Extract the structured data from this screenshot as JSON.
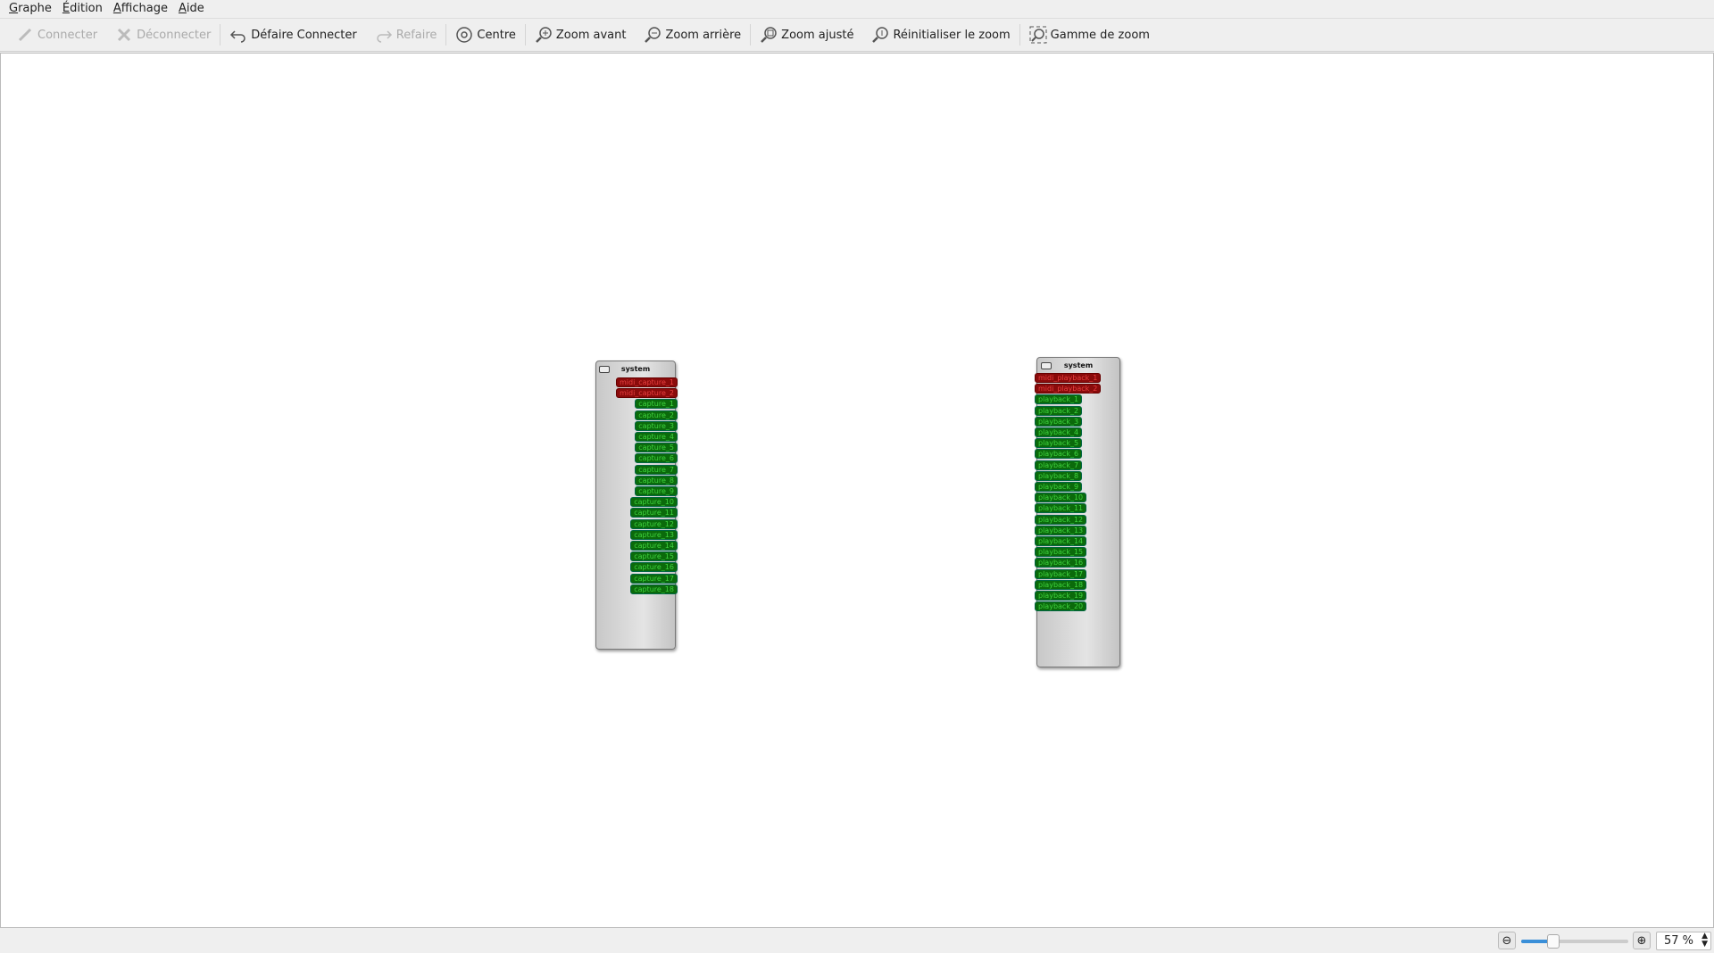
{
  "menu": [
    "Graphe",
    "Édition",
    "Affichage",
    "Aide"
  ],
  "toolbar": {
    "connect": "Connecter",
    "disconnect": "Déconnecter",
    "undo": "Défaire Connecter",
    "redo": "Refaire",
    "center": "Centre",
    "zoom_in": "Zoom avant",
    "zoom_out": "Zoom arrière",
    "zoom_fit": "Zoom ajusté",
    "zoom_reset": "Réinitialiser le zoom",
    "zoom_range": "Gamme de zoom"
  },
  "capture_client": {
    "title": "system",
    "midi_ports": [
      "midi_capture_1",
      "midi_capture_2"
    ],
    "audio_ports": [
      "capture_1",
      "capture_2",
      "capture_3",
      "capture_4",
      "capture_5",
      "capture_6",
      "capture_7",
      "capture_8",
      "capture_9",
      "capture_10",
      "capture_11",
      "capture_12",
      "capture_13",
      "capture_14",
      "capture_15",
      "capture_16",
      "capture_17",
      "capture_18"
    ]
  },
  "playback_client": {
    "title": "system",
    "midi_ports": [
      "midi_playback_1",
      "midi_playback_2"
    ],
    "audio_ports": [
      "playback_1",
      "playback_2",
      "playback_3",
      "playback_4",
      "playback_5",
      "playback_6",
      "playback_7",
      "playback_8",
      "playback_9",
      "playback_10",
      "playback_11",
      "playback_12",
      "playback_13",
      "playback_14",
      "playback_15",
      "playback_16",
      "playback_17",
      "playback_18",
      "playback_19",
      "playback_20"
    ]
  },
  "status": {
    "zoom_label": "57 %",
    "zoom_fraction": 0.3
  }
}
